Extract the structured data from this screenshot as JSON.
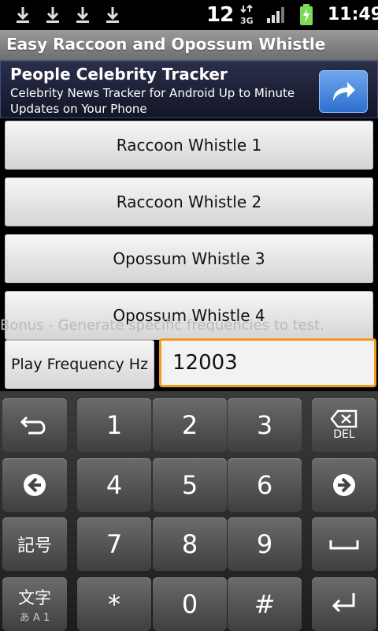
{
  "status_bar": {
    "notification_count": "12",
    "network": "3G",
    "time": "11:49"
  },
  "title_bar": {
    "title": "Easy Raccoon and Opossum Whistle"
  },
  "ad": {
    "title": "People Celebrity Tracker",
    "text": "Celebrity News Tracker for Android Up to Minute Updates on Your Phone"
  },
  "whistles": [
    {
      "label": "Raccoon Whistle 1"
    },
    {
      "label": "Raccoon Whistle 2"
    },
    {
      "label": "Opossum Whistle 3"
    },
    {
      "label": "Opossum Whistle 4"
    }
  ],
  "bonus": {
    "text": "Bonus - Generate specific frequencies to test."
  },
  "frequency": {
    "button_label": "Play Frequency Hz",
    "value": "12003"
  },
  "keyboard": {
    "digits": [
      "1",
      "2",
      "3",
      "4",
      "5",
      "6",
      "7",
      "8",
      "9",
      "*",
      "0",
      "#"
    ],
    "del_label": "DEL",
    "symbols_label": "記号",
    "mode_label": "文字",
    "mode_sub": "あ A 1"
  },
  "colors": {
    "input_focus": "#f39b1c",
    "ad_button": "#2e6fcf"
  }
}
